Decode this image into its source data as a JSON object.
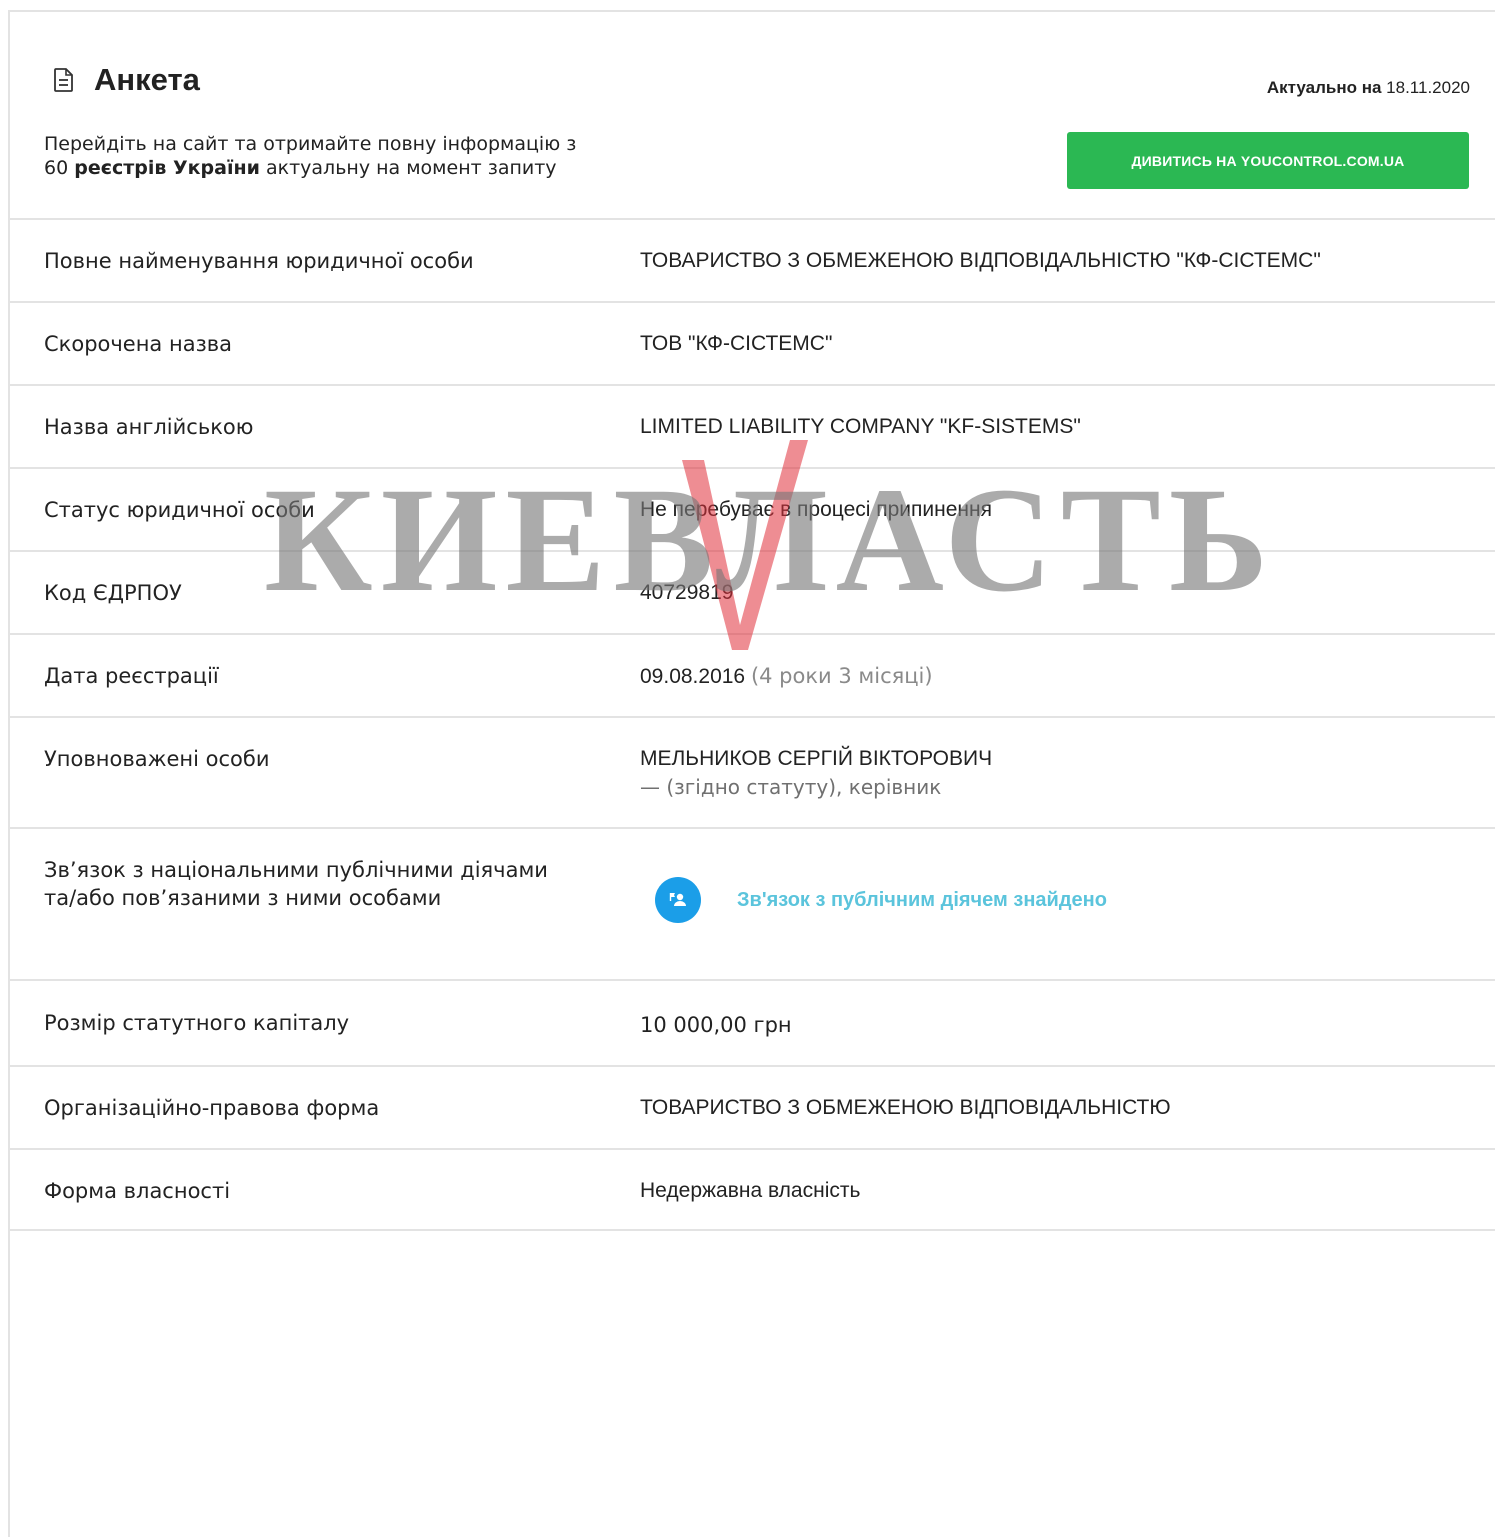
{
  "header": {
    "title": "Анкета",
    "actual_label": "Актуально на",
    "actual_date": "18.11.2020",
    "promo_line1": "Перейдіть на сайт та отримайте повну інформацію з",
    "promo_count": "60",
    "promo_bold": "реєстрів України",
    "promo_rest": "актуальну на момент запиту",
    "cta_label": "ДИВИТИСЬ НА YOUCONTROL.COM.UA"
  },
  "rows": {
    "full_name": {
      "label": "Повне найменування юридичної особи",
      "value": "ТОВАРИСТВО З ОБМЕЖЕНОЮ ВІДПОВІДАЛЬНІСТЮ \"КФ-СІСТЕМС\""
    },
    "short_name": {
      "label": "Скорочена назва",
      "value": "ТОВ \"КФ-СІСТЕМС\""
    },
    "english_name": {
      "label": "Назва англійською",
      "value": "LIMITED LIABILITY COMPANY \"KF-SISTEMS\""
    },
    "status": {
      "label": "Статус юридичної особи",
      "value": "Не перебуває в процесі припинення"
    },
    "edrpou": {
      "label": "Код ЄДРПОУ",
      "value": "40729819"
    },
    "reg_date": {
      "label": "Дата реєстрації",
      "value": "09.08.2016",
      "age": "(4 роки 3 місяці)"
    },
    "authorized": {
      "label": "Уповноважені особи",
      "value": "МЕЛЬНИКОВ СЕРГІЙ ВІКТОРОВИЧ",
      "role": "— (згідно статуту), керівник"
    },
    "pep": {
      "label_line1": "Зв’язок з національними публічними діячами",
      "label_line2": "та/або пов’язаними з ними особами",
      "value": "Зв'язок з публічним діячем знайдено"
    },
    "capital": {
      "label": "Розмір статутного капіталу",
      "value": "10 000,00 грн"
    },
    "legal_form": {
      "label": "Організаційно-правова форма",
      "value": "ТОВАРИСТВО З ОБМЕЖЕНОЮ ВІДПОВІДАЛЬНІСТЮ"
    },
    "ownership": {
      "label": "Форма власності",
      "value": "Недержавна власність"
    }
  },
  "watermark": {
    "text": "КИЕВЛАСТЬ",
    "accent_color": "#e0303a"
  },
  "colors": {
    "cta": "#2bb853",
    "pep_icon": "#1b9ee8",
    "pep_text": "#5bc4dc"
  }
}
